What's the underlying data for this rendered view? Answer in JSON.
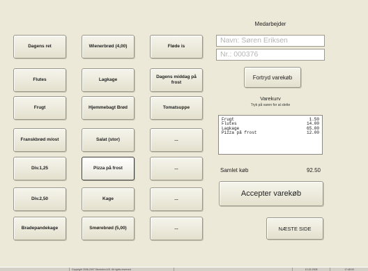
{
  "products": {
    "col1": [
      "Dagens ret",
      "Flutes",
      "Frugt",
      "Franskbrød m/ost",
      "Div.1,25",
      "Div.2,50",
      "Bradepandekage"
    ],
    "col2": [
      "Wienerbrød (4,00)",
      "Lagkage",
      "Hjemmebagt Brød",
      "Salat (stor)",
      "Pizza på frost",
      "Kage",
      "Smørebrød (5,00)"
    ],
    "col3": [
      "Fløde is",
      "Dagens middag på frost",
      "Tomatsuppe",
      "...",
      "...",
      "...",
      "..."
    ]
  },
  "employee": {
    "heading": "Medarbejder",
    "name_field": "Navn: Søren Eriksen",
    "number_field": "Nr.: 000376",
    "continue_button": "Fortryd varekøb"
  },
  "cart": {
    "title": "Varekurv",
    "hint": "Tryk på varen for at slette",
    "items": [
      {
        "name": "Frugt",
        "price": "1.50"
      },
      {
        "name": "Flutes",
        "price": "14.00"
      },
      {
        "name": "Lagkage",
        "price": "65.00"
      },
      {
        "name": "Pizza på frost",
        "price": "12.00"
      }
    ],
    "total_label": "Samlet køb",
    "total_value": "92.50"
  },
  "actions": {
    "accept_button": "Accepter varekøb",
    "next_page_button": "NÆSTE SIDE"
  },
  "statusbar": {
    "copyright": "Copyright 2006-2007 Stentofon A/S. All rights reserved",
    "date": "12-02-2008",
    "time": "17:48:00"
  },
  "colors": {
    "background": "#ece9d8",
    "field_placeholder": "#b4b4b4"
  }
}
